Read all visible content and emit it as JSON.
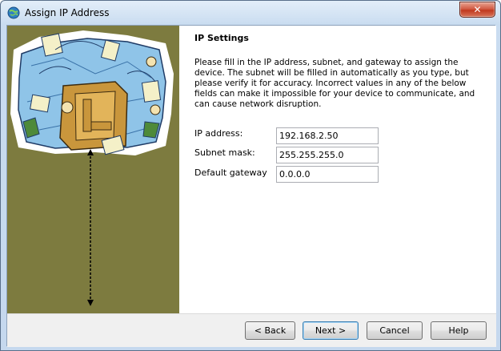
{
  "window": {
    "title": "Assign IP Address",
    "close_glyph": "✕",
    "icon": "network-globe-icon"
  },
  "sidebar": {
    "image": "network-collage-illustration",
    "background_color": "#7d7b3f"
  },
  "main": {
    "heading": "IP Settings",
    "description": "Please fill in the IP address, subnet, and gateway to assign the device. The subnet will be filled in automatically as you type, but please verify it for accuracy.  Incorrect values in any of the below fields can make it impossible for your device to communicate, and can cause network disruption.",
    "fields": {
      "ip_address": {
        "label": "IP address:",
        "value": "192.168.2.50"
      },
      "subnet_mask": {
        "label": "Subnet mask:",
        "value": "255.255.255.0"
      },
      "default_gateway": {
        "label": "Default gateway",
        "value": "0.0.0.0"
      }
    }
  },
  "footer": {
    "back_label": "< Back",
    "next_label": "Next >",
    "cancel_label": "Cancel",
    "help_label": "Help"
  }
}
